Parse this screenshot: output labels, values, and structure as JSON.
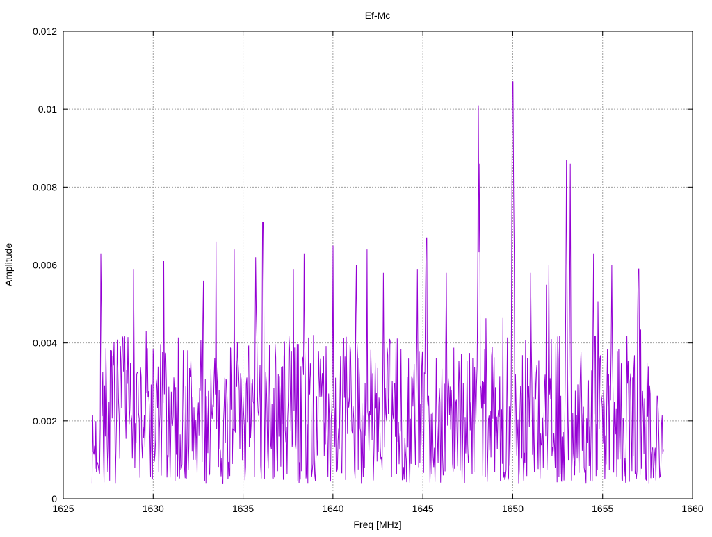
{
  "chart_data": {
    "type": "line",
    "title": "Ef-Mc",
    "xlabel": "Freq [MHz]",
    "ylabel": "Amplitude",
    "xlim": [
      1625,
      1660
    ],
    "ylim": [
      0,
      0.012
    ],
    "xticks": [
      1625,
      1630,
      1635,
      1640,
      1645,
      1650,
      1655,
      1660
    ],
    "xtick_labels": [
      "1625",
      "1630",
      "1635",
      "1640",
      "1645",
      "1650",
      "1655",
      "1660"
    ],
    "yticks": [
      0,
      0.002,
      0.004,
      0.006,
      0.008,
      0.01,
      0.012
    ],
    "ytick_labels": [
      "0",
      "0.002",
      "0.004",
      "0.006",
      "0.008",
      "0.01",
      "0.012"
    ],
    "grid": true,
    "legend": "none",
    "series": [
      {
        "name": "Ef-Mc",
        "color": "#9400d3",
        "x_start": 1626.6,
        "x_end": 1658.4,
        "x_step": 0.035,
        "baseline_range": [
          0.0004,
          0.0042
        ],
        "noise_seed": 7,
        "peaks": [
          {
            "x": 1627.1,
            "y": 0.0063
          },
          {
            "x": 1628.9,
            "y": 0.0059
          },
          {
            "x": 1629.6,
            "y": 0.0043
          },
          {
            "x": 1630.6,
            "y": 0.0061
          },
          {
            "x": 1632.8,
            "y": 0.0056
          },
          {
            "x": 1633.5,
            "y": 0.0066
          },
          {
            "x": 1634.5,
            "y": 0.0064
          },
          {
            "x": 1635.7,
            "y": 0.0062
          },
          {
            "x": 1636.1,
            "y": 0.0071
          },
          {
            "x": 1637.8,
            "y": 0.0059
          },
          {
            "x": 1638.4,
            "y": 0.0063
          },
          {
            "x": 1640.0,
            "y": 0.0065
          },
          {
            "x": 1641.3,
            "y": 0.006
          },
          {
            "x": 1641.9,
            "y": 0.0064
          },
          {
            "x": 1642.8,
            "y": 0.0058
          },
          {
            "x": 1644.7,
            "y": 0.0059
          },
          {
            "x": 1645.2,
            "y": 0.0067
          },
          {
            "x": 1646.3,
            "y": 0.0058
          },
          {
            "x": 1648.1,
            "y": 0.0101
          },
          {
            "x": 1648.15,
            "y": 0.0086
          },
          {
            "x": 1650.0,
            "y": 0.0107
          },
          {
            "x": 1650.05,
            "y": 0.0079
          },
          {
            "x": 1651.0,
            "y": 0.0058
          },
          {
            "x": 1652.0,
            "y": 0.006
          },
          {
            "x": 1653.0,
            "y": 0.0087
          },
          {
            "x": 1653.2,
            "y": 0.0086
          },
          {
            "x": 1654.5,
            "y": 0.0063
          },
          {
            "x": 1655.5,
            "y": 0.006
          },
          {
            "x": 1657.0,
            "y": 0.0059
          }
        ]
      }
    ]
  }
}
